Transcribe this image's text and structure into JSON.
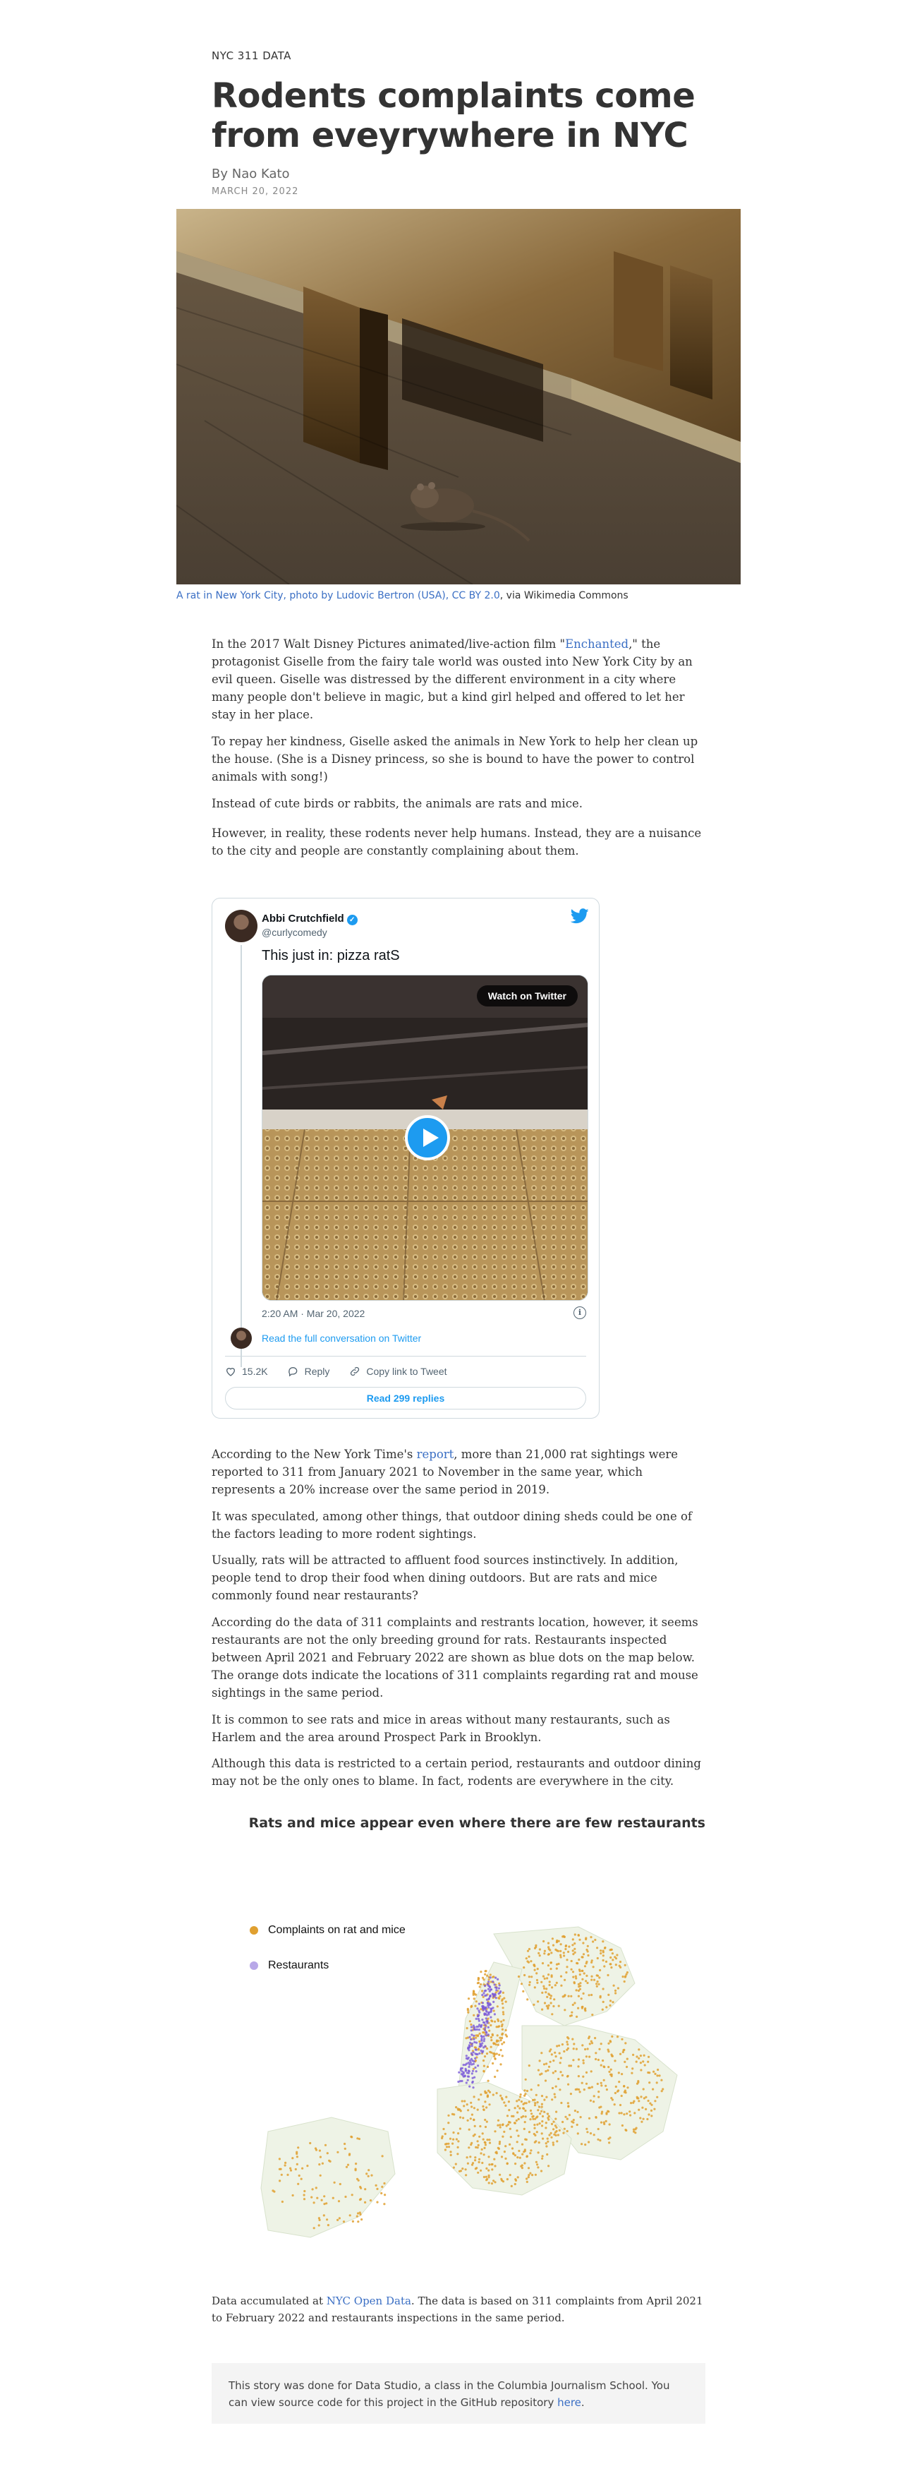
{
  "article": {
    "kicker": "NYC 311 DATA",
    "headline": "Rodents complaints come from eveyrywhere in NYC",
    "byline": "By Nao Kato",
    "date": "MARCH 20, 2022"
  },
  "hero": {
    "caption_link1": "A rat in New York City, photo by Ludovic Bertron (USA), CC BY 2.0",
    "caption_rest": ", via Wikimedia Commons"
  },
  "intro": {
    "p1_a": "In the 2017 Walt Disney Pictures animated/live-action film \"",
    "p1_link": "Enchanted",
    "p1_b": ",\" the protagonist Giselle from the fairy tale world was ousted into New York City by an evil queen. Giselle was distressed by the different environment in a city where many people don't believe in magic, but a kind girl helped and offered to let her stay in her place.",
    "p2": "To repay her kindness, Giselle asked the animals in New York to help her clean up the house. (She is a Disney princess, so she is bound to have the power to control animals with song!)",
    "p3": "Instead of cute birds or rabbits, the animals are rats and mice.",
    "p4": "However, in reality, these rodents never help humans. Instead, they are a nuisance to the city and people are constantly complaining about them."
  },
  "tweet": {
    "name": "Abbi Crutchfield",
    "handle": "@curlycomedy",
    "text": "This just in: pizza ratS",
    "watch_label": "Watch on Twitter",
    "time": "2:20 AM · Mar 20, 2022",
    "read_conversation": "Read the full conversation on Twitter",
    "likes": "15.2K",
    "reply_label": "Reply",
    "copy_link_label": "Copy link to Tweet",
    "replies_button": "Read 299 replies"
  },
  "body": {
    "p5_a": "According to the New York Time's ",
    "p5_link": "report",
    "p5_b": ", more than 21,000 rat sightings were reported to 311 from January 2021 to November in the same year, which represents a 20% increase over the same period in 2019.",
    "p6": "It was speculated, among other things, that outdoor dining sheds could be one of the factors leading to more rodent sightings.",
    "p7": "Usually, rats will be attracted to affluent food sources instinctively. In addition, people tend to drop their food when dining outdoors. But are rats and mice commonly found near restaurants?",
    "p8": "According do the data of 311 complaints and restrants location, however, it seems restaurants are not the only breeding ground for rats. Restaurants inspected between April 2021 and February 2022 are shown as blue dots on the map below. The orange dots indicate the locations of 311 complaints regarding rat and mouse sightings in the same period.",
    "p9": "It is common to see rats and mice in areas without many restaurants, such as Harlem and the area around Prospect Park in Brooklyn.",
    "p10": "Although this data is restricted to a certain period, restaurants and outdoor dining may not be the only ones to blame. In fact, rodents are everywhere in the city."
  },
  "map": {
    "title": "Rats and mice appear even where there are few restaurants",
    "legend_complaints": "Complaints on rat and mice",
    "legend_restaurants": "Restaurants",
    "color_complaints": "#e0a030",
    "color_restaurants": "#b8a8e8",
    "color_land": "#eef3e6"
  },
  "source": {
    "a": "Data accumulated at ",
    "link": "NYC Open Data",
    "b": ". The data is based on 311 complaints from April 2021 to February 2022 and restaurants inspections in the same period."
  },
  "footer": {
    "a": "This story was done for Data Studio, a class in the Columbia Journalism School. You can view source code for this project in the GitHub repository ",
    "link": "here",
    "b": "."
  }
}
